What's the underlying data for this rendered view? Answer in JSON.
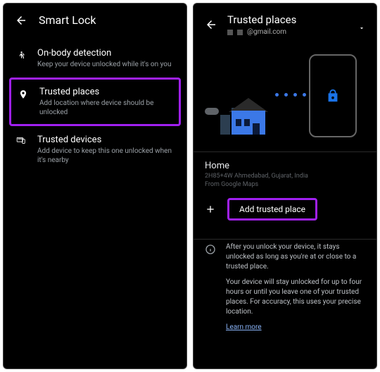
{
  "left": {
    "title": "Smart Lock",
    "options": [
      {
        "title": "On-body detection",
        "sub": "Keep your device unlocked while it's on you"
      },
      {
        "title": "Trusted places",
        "sub": "Add location where device should be unlocked"
      },
      {
        "title": "Trusted devices",
        "sub": "Add device to keep this one unlocked when it's nearby"
      }
    ]
  },
  "right": {
    "title": "Trusted places",
    "account": "@gmail.com",
    "place": {
      "name": "Home",
      "addr": "2H85+4W Ahmedabad, Gujarat, India",
      "src": "From Google Maps"
    },
    "add_label": "Add trusted place",
    "info1": "After you unlock your device, it stays unlocked as long as you're at or close to a trusted place.",
    "info2": "Your device will stay unlocked for up to four hours or until you leave one of your trusted places. For accuracy, this uses your precise location.",
    "learn": "Learn more"
  }
}
